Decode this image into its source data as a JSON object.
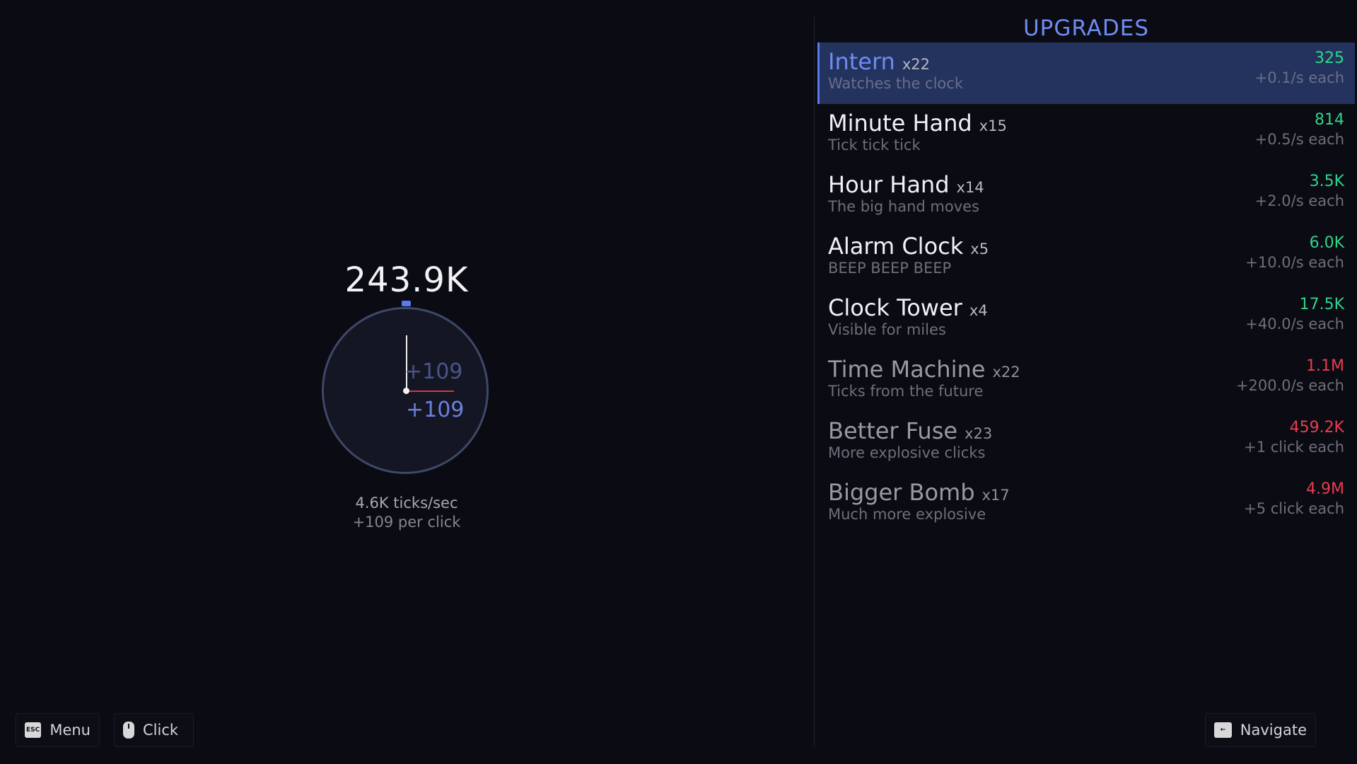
{
  "game": {
    "score": "243.9K",
    "floating_a": "+109",
    "floating_b": "+109",
    "ticks_per_sec": "4.6K ticks/sec",
    "per_click": "+109 per click"
  },
  "controls": {
    "menu_key": "ESC",
    "menu_label": "Menu",
    "click_label": "Click",
    "navigate_label": "Navigate"
  },
  "upgrades": {
    "title": "UPGRADES",
    "items": [
      {
        "name": "Intern",
        "count": "x22",
        "desc": "Watches the clock",
        "cost": "325",
        "rate": "+0.1/s each",
        "affordable": true,
        "selected": true
      },
      {
        "name": "Minute Hand",
        "count": "x15",
        "desc": "Tick tick tick",
        "cost": "814",
        "rate": "+0.5/s each",
        "affordable": true
      },
      {
        "name": "Hour Hand",
        "count": "x14",
        "desc": "The big hand moves",
        "cost": "3.5K",
        "rate": "+2.0/s each",
        "affordable": true
      },
      {
        "name": "Alarm Clock",
        "count": "x5",
        "desc": "BEEP BEEP BEEP",
        "cost": "6.0K",
        "rate": "+10.0/s each",
        "affordable": true
      },
      {
        "name": "Clock Tower",
        "count": "x4",
        "desc": "Visible for miles",
        "cost": "17.5K",
        "rate": "+40.0/s each",
        "affordable": true
      },
      {
        "name": "Time Machine",
        "count": "x22",
        "desc": "Ticks from the future",
        "cost": "1.1M",
        "rate": "+200.0/s each",
        "affordable": false
      },
      {
        "name": "Better Fuse",
        "count": "x23",
        "desc": "More explosive clicks",
        "cost": "459.2K",
        "rate": "+1 click each",
        "affordable": false
      },
      {
        "name": "Bigger Bomb",
        "count": "x17",
        "desc": "Much more explosive",
        "cost": "4.9M",
        "rate": "+5 click each",
        "affordable": false
      }
    ]
  },
  "colors": {
    "accent": "#6e8cf2",
    "affordable": "#2fd48a",
    "unaffordable": "#e83c50"
  }
}
